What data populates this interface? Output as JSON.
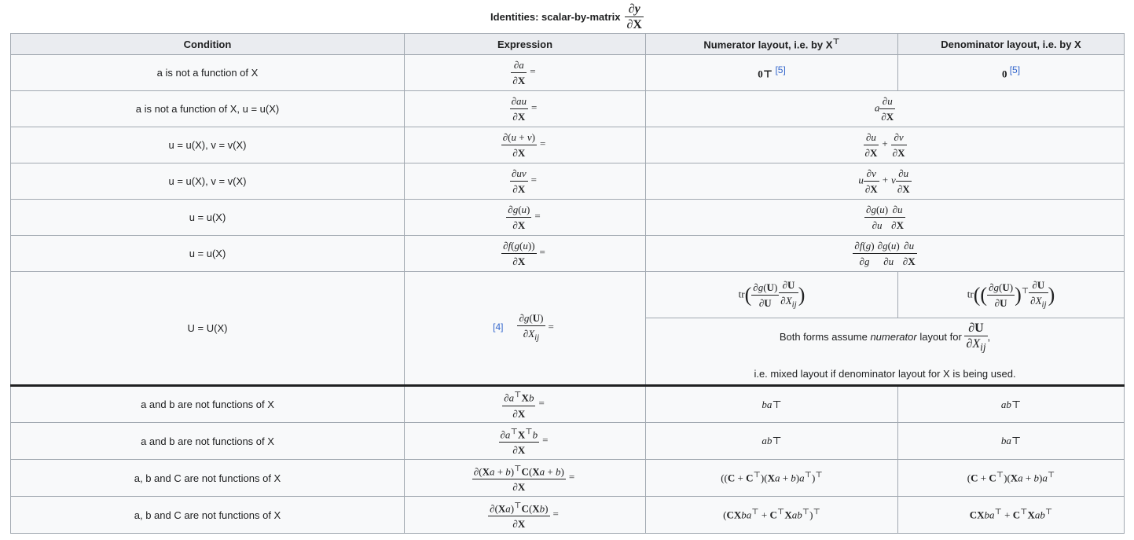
{
  "caption": {
    "text": "Identities: scalar-by-matrix"
  },
  "headers": {
    "condition": "Condition",
    "expression": "Expression",
    "numerator": "Numerator layout, i.e. by X",
    "numerator_sup": "⊤",
    "denominator": "Denominator layout, i.e. by X"
  },
  "rows": [
    {
      "condition": "a is not a function of X",
      "num": "0⊤",
      "den": "0",
      "ref": "[5]"
    },
    {
      "condition": "a is not a function of X, u = u(X)"
    },
    {
      "condition": "u = u(X), v = v(X)"
    },
    {
      "condition": "u = u(X), v = v(X)"
    },
    {
      "condition": "u = u(X)"
    },
    {
      "condition": "u = u(X)"
    },
    {
      "condition": "U = U(X)",
      "ref": "[4]",
      "note_pre": "Both forms assume",
      "note_em": "numerator",
      "note_post": "layout for",
      "note_line2": "i.e. mixed layout if denominator layout for X is being used."
    },
    {
      "condition": "a and b are not functions of X",
      "num": "ba⊤",
      "den": "ab⊤"
    },
    {
      "condition": "a and b are not functions of X",
      "num": "ab⊤",
      "den": "ba⊤"
    },
    {
      "condition": "a, b and C are not functions of X"
    },
    {
      "condition": "a, b and C are not functions of X"
    }
  ]
}
